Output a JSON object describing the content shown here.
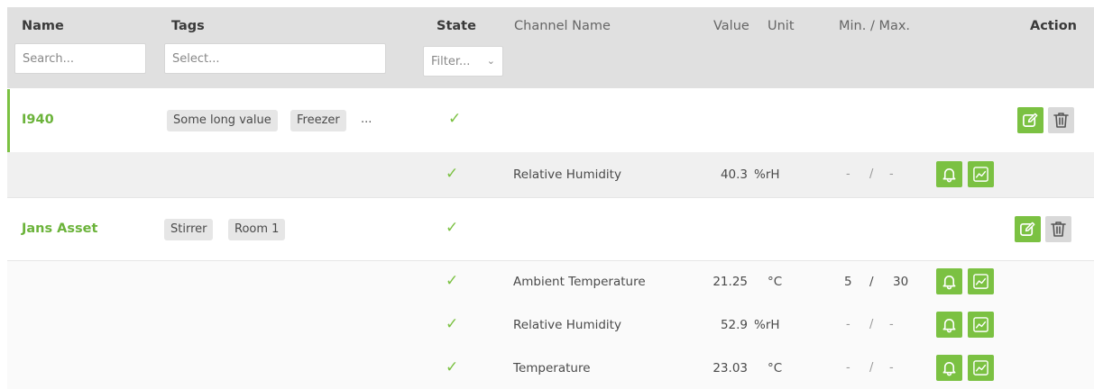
{
  "header": {
    "name_label": "Name",
    "tags_label": "Tags",
    "state_label": "State",
    "channel_label": "Channel Name",
    "value_label": "Value",
    "unit_label": "Unit",
    "minmax_label": "Min. / Max.",
    "action_label": "Action",
    "name_placeholder": "Search...",
    "tags_placeholder": "Select...",
    "state_filter": "Filter..."
  },
  "assets": [
    {
      "name": "I940",
      "tags": [
        "Some long value",
        "Freezer"
      ],
      "more": "...",
      "channels": [
        {
          "name": "Relative Humidity",
          "value": "40.3",
          "unit": "%rH",
          "min": "-",
          "sep": "/",
          "max": "-"
        }
      ]
    },
    {
      "name": "Jans Asset",
      "tags": [
        "Stirrer",
        "Room 1"
      ],
      "channels": [
        {
          "name": "Ambient Temperature",
          "value": "21.25",
          "unit": "°C",
          "min": "5",
          "sep": "/",
          "max": "30"
        },
        {
          "name": "Relative Humidity",
          "value": "52.9",
          "unit": "%rH",
          "min": "-",
          "sep": "/",
          "max": "-"
        },
        {
          "name": "Temperature",
          "value": "23.03",
          "unit": "°C",
          "min": "-",
          "sep": "/",
          "max": "-"
        }
      ]
    }
  ],
  "state_check": "✓",
  "icons": {
    "state": "check-icon",
    "edit": "edit-icon",
    "delete": "trash-icon",
    "alarm": "bell-icon",
    "chart": "chart-icon"
  },
  "colors": {
    "accent": "#7bc142",
    "header_bg": "#e0e0e0",
    "channel_bg": "#f0f0f0"
  }
}
